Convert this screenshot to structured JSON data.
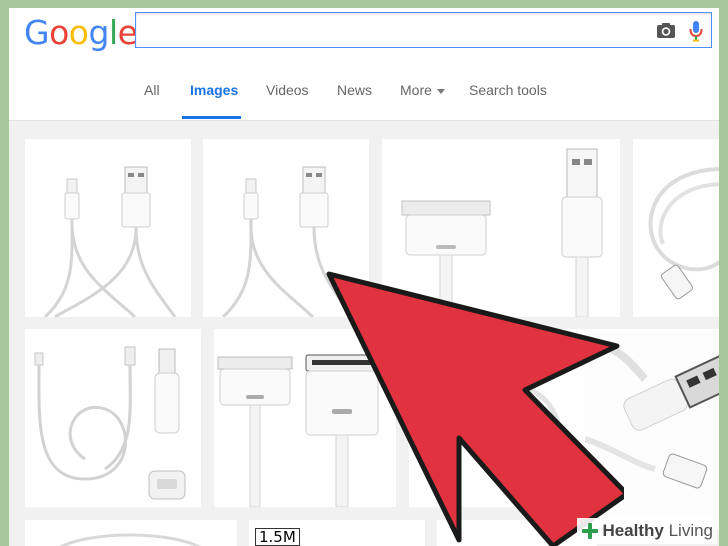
{
  "header": {
    "logo": [
      "G",
      "o",
      "o",
      "g",
      "l",
      "e"
    ],
    "logo_colors": [
      "#4285f4",
      "#ea4335",
      "#fbbc05",
      "#4285f4",
      "#34a853",
      "#ea4335"
    ],
    "search": {
      "value": "",
      "placeholder": ""
    }
  },
  "tabs": {
    "all": "All",
    "images": "Images",
    "videos": "Videos",
    "news": "News",
    "more": "More",
    "search_tools": "Search tools"
  },
  "results": {
    "size_chip": "1.5M"
  },
  "watermark": {
    "brand_a": "Healthy",
    "brand_b": " Living"
  },
  "colors": {
    "accent": "#1a73e8",
    "arrow": "#e0323f",
    "background_frame": "#a8c79a",
    "watermark_green": "#2e9f4e"
  },
  "icons": {
    "camera": "camera-icon",
    "mic": "microphone-icon",
    "arrow": "pointer-arrow-icon",
    "watermark": "cross-leaf-icon"
  }
}
